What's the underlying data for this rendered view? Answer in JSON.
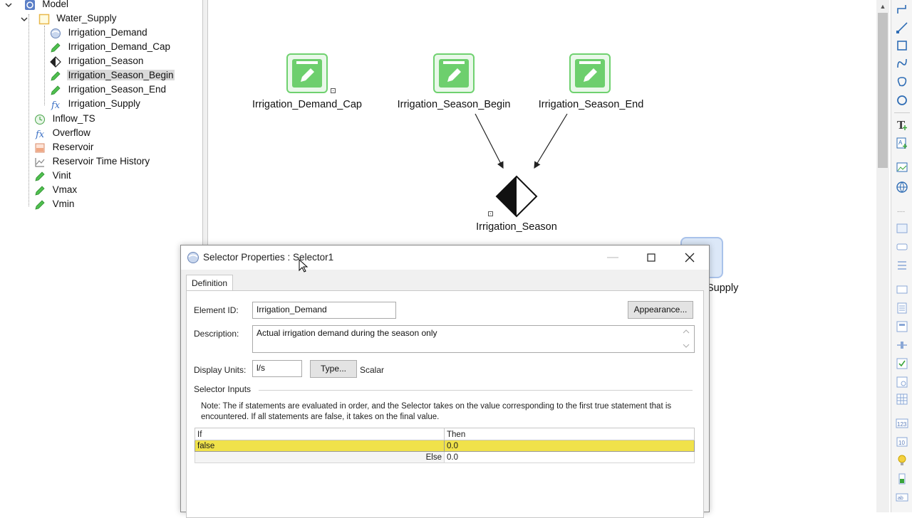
{
  "tree": {
    "root": "Model",
    "container": "Water_Supply",
    "children": [
      "Irrigation_Demand",
      "Irrigation_Demand_Cap",
      "Irrigation_Season",
      "Irrigation_Season_Begin",
      "Irrigation_Season_End",
      "Irrigation_Supply"
    ],
    "siblings": [
      "Inflow_TS",
      "Overflow",
      "Reservoir",
      "Reservoir Time History",
      "Vinit",
      "Vmax",
      "Vmin"
    ]
  },
  "canvas": {
    "nodes": {
      "demand_cap": "Irrigation_Demand_Cap",
      "season_begin": "Irrigation_Season_Begin",
      "season_end": "Irrigation_Season_End",
      "season": "Irrigation_Season",
      "supply_partial": "Supply"
    }
  },
  "dialog": {
    "title": "Selector Properties : Selector1",
    "tab": "Definition",
    "element_id_label": "Element ID:",
    "element_id_value": "Irrigation_Demand",
    "appearance_button": "Appearance...",
    "description_label": "Description:",
    "description_value": "Actual irrigation demand during the season only",
    "display_units_label": "Display Units:",
    "display_units_value": "l/s",
    "type_button": "Type...",
    "type_value": "Scalar",
    "section_title": "Selector Inputs",
    "note": "Note: The if statements are evaluated in order, and the Selector takes on the value corresponding to the first true statement that is encountered. If all statements are false, it takes on the final value.",
    "table": {
      "col_if": "If",
      "col_then": "Then",
      "rows": [
        {
          "if": "false",
          "then": "0.0"
        }
      ],
      "else_label": "Else",
      "else_value": "0.0"
    },
    "highlight_color": "#f0e24a"
  }
}
